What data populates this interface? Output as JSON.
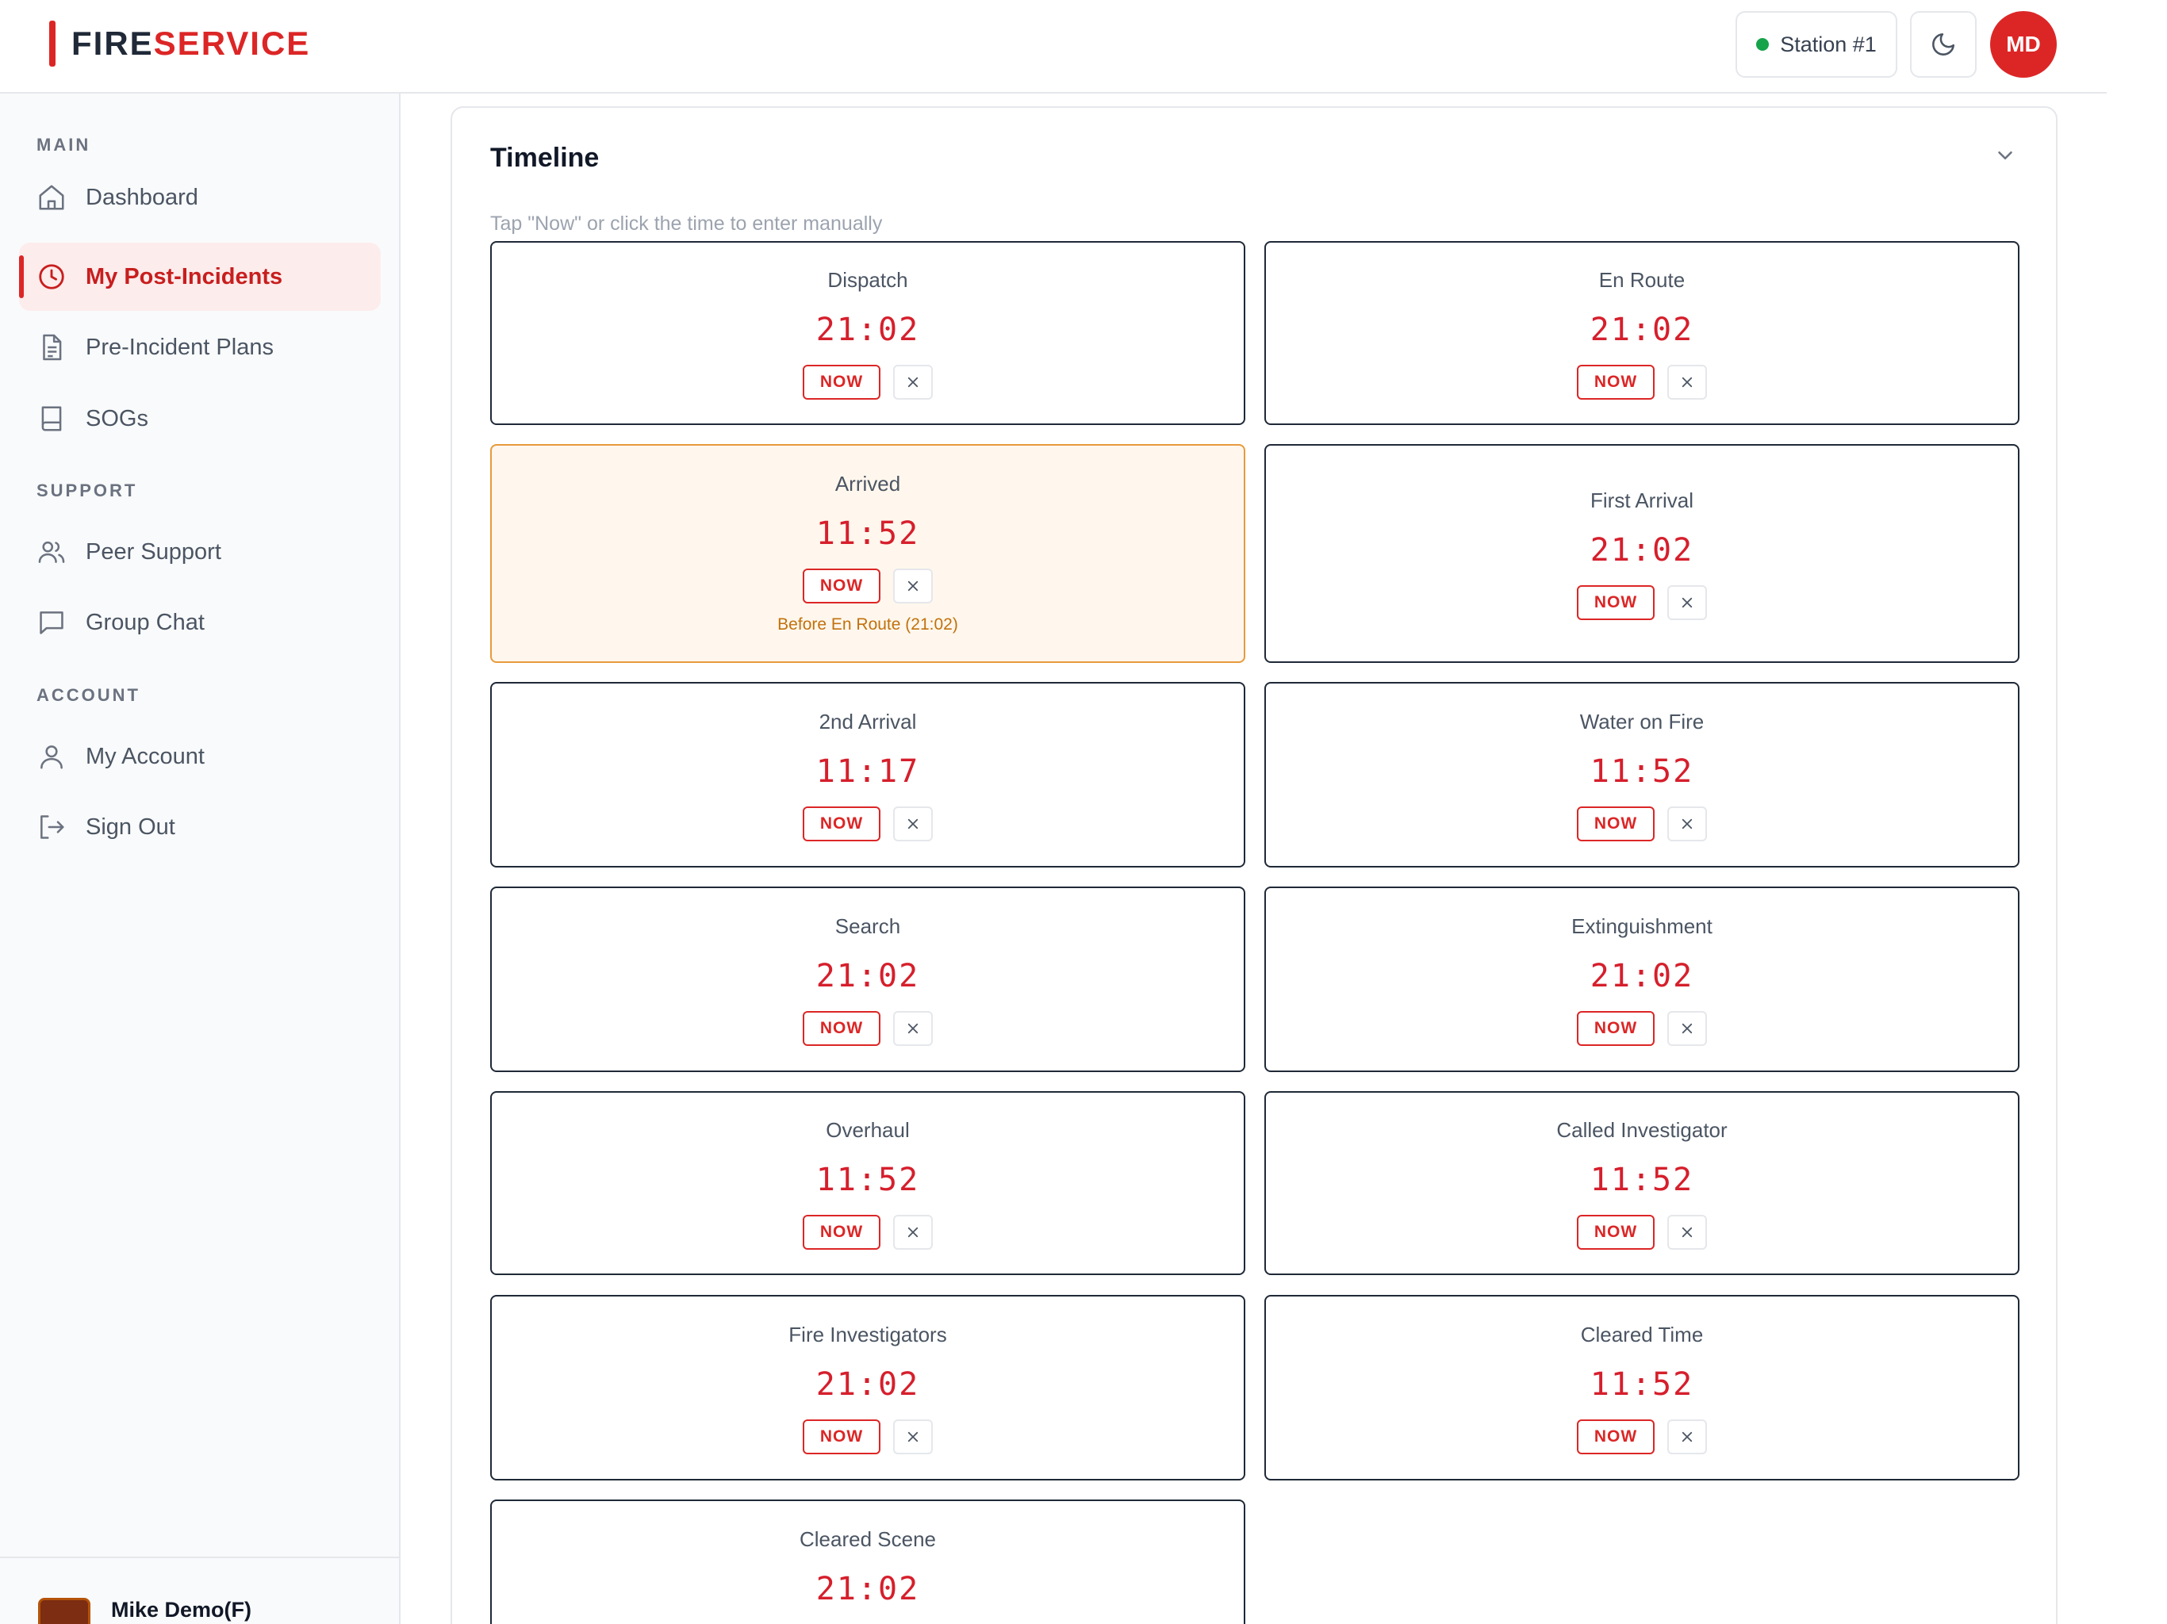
{
  "header": {
    "logo_part1": "FIRE",
    "logo_part2": "SERVICE",
    "station_label": "Station #1",
    "theme_icon": "moon-icon",
    "avatar_initials": "MD"
  },
  "colors": {
    "brand_red": "#dc2626",
    "status_online": "#16a34a",
    "warning_orange": "#e89a3c"
  },
  "sidebar": {
    "sections": [
      {
        "label": "MAIN"
      },
      {
        "label": "SUPPORT"
      },
      {
        "label": "ACCOUNT"
      }
    ],
    "items": [
      {
        "label": "Dashboard",
        "icon": "home-icon"
      },
      {
        "label": "My Post-Incidents",
        "icon": "clock-icon",
        "active": true
      },
      {
        "label": "Pre-Incident Plans",
        "icon": "document-icon"
      },
      {
        "label": "SOGs",
        "icon": "book-icon"
      },
      {
        "label": "Peer Support",
        "icon": "users-icon"
      },
      {
        "label": "Group Chat",
        "icon": "chat-icon"
      },
      {
        "label": "My Account",
        "icon": "user-icon"
      },
      {
        "label": "Sign Out",
        "icon": "sign-out-icon"
      }
    ],
    "user_name": "Mike Demo(F)"
  },
  "timeline": {
    "title": "Timeline",
    "hint": "Tap \"Now\" or click the time to enter manually",
    "now_label": "NOW",
    "entries": [
      {
        "label": "Dispatch",
        "time": "21:02"
      },
      {
        "label": "En Route",
        "time": "21:02"
      },
      {
        "label": "Arrived",
        "time": "11:52",
        "warning": "Before En Route (21:02)"
      },
      {
        "label": "First Arrival",
        "time": "21:02"
      },
      {
        "label": "2nd Arrival",
        "time": "11:17"
      },
      {
        "label": "Water on Fire",
        "time": "11:52"
      },
      {
        "label": "Search",
        "time": "21:02"
      },
      {
        "label": "Extinguishment",
        "time": "21:02"
      },
      {
        "label": "Overhaul",
        "time": "11:52"
      },
      {
        "label": "Called Investigator",
        "time": "11:52"
      },
      {
        "label": "Fire Investigators",
        "time": "21:02"
      },
      {
        "label": "Cleared Time",
        "time": "11:52"
      },
      {
        "label": "Cleared Scene",
        "time": "21:02"
      }
    ]
  }
}
